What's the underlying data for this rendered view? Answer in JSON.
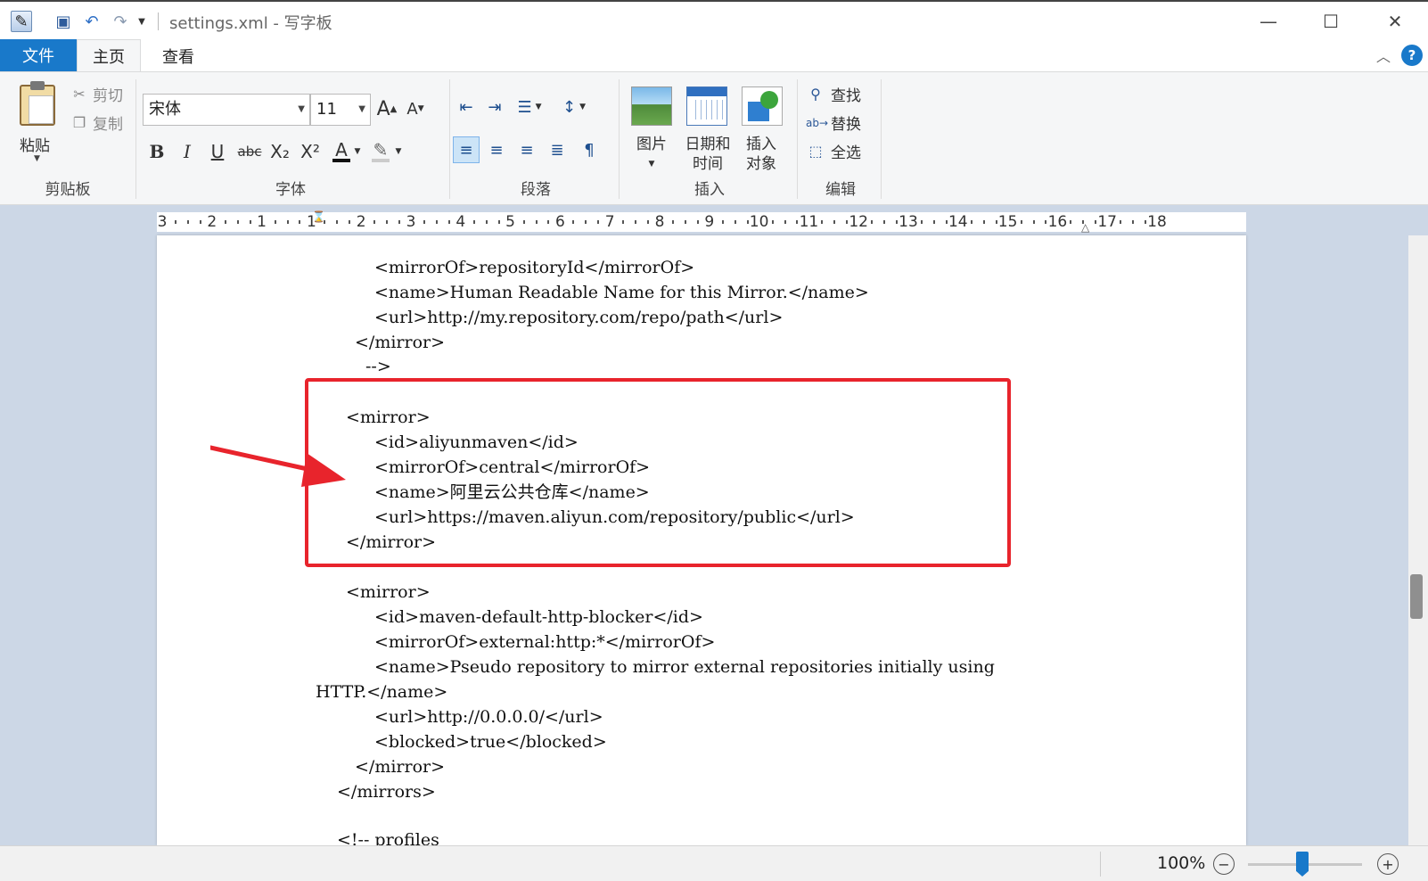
{
  "window": {
    "title": "settings.xml - 写字板",
    "minimize_glyph": "—",
    "maximize_glyph": "☐",
    "close_glyph": "✕"
  },
  "quick_access": [
    "save-icon",
    "undo-icon",
    "redo-icon",
    "customize-dropdown-icon"
  ],
  "tabs": {
    "file": "文件",
    "items": [
      {
        "label": "主页",
        "active": true
      },
      {
        "label": "查看",
        "active": false
      }
    ]
  },
  "ribbon": {
    "clipboard": {
      "group_label": "剪贴板",
      "paste": "粘贴",
      "cut": "剪切",
      "copy": "复制"
    },
    "font": {
      "group_label": "字体",
      "family": "宋体",
      "size": "11",
      "grow_glyph": "A",
      "shrink_glyph": "A",
      "bold": "B",
      "italic": "I",
      "underline": "U",
      "strikethrough": "abc",
      "subscript": "X₂",
      "superscript": "X²",
      "color_glyph": "A",
      "highlight_glyph": "✎"
    },
    "paragraph": {
      "group_label": "段落",
      "active_alignment": "left"
    },
    "insert": {
      "group_label": "插入",
      "picture": "图片",
      "datetime_line1": "日期和",
      "datetime_line2": "时间",
      "object_line1": "插入",
      "object_line2": "对象"
    },
    "editing": {
      "group_label": "编辑",
      "find": "查找",
      "replace": "替换",
      "select_all": "全选"
    }
  },
  "ruler": {
    "labels": [
      "3",
      "2",
      "1",
      "1",
      "2",
      "3",
      "4",
      "5",
      "6",
      "7",
      "8",
      "9",
      "10",
      "11",
      "12",
      "13",
      "14",
      "15",
      "16",
      "17",
      "18"
    ]
  },
  "document": {
    "lines": [
      "<mirrorOf>repositoryId</mirrorOf>",
      "<name>Human Readable Name for this Mirror.</name>",
      "<url>http://my.repository.com/repo/path</url>",
      "</mirror>",
      "-->",
      "<mirror>",
      "<id>aliyunmaven</id>",
      "<mirrorOf>central</mirrorOf>",
      "<name>阿里云公共仓库</name>",
      "<url>https://maven.aliyun.com/repository/public</url>",
      "</mirror>",
      "<mirror>",
      "<id>maven-default-http-blocker</id>",
      "<mirrorOf>external:http:*</mirrorOf>",
      "<name>Pseudo repository to mirror external repositories initially using",
      "HTTP.</name>",
      "<url>http://0.0.0.0/</url>",
      "<blocked>true</blocked>",
      "</mirror>",
      "</mirrors>",
      "<!-- profiles"
    ],
    "highlight_color": "#e8242c"
  },
  "status": {
    "zoom": "100%",
    "zoom_level_percent": 100
  }
}
